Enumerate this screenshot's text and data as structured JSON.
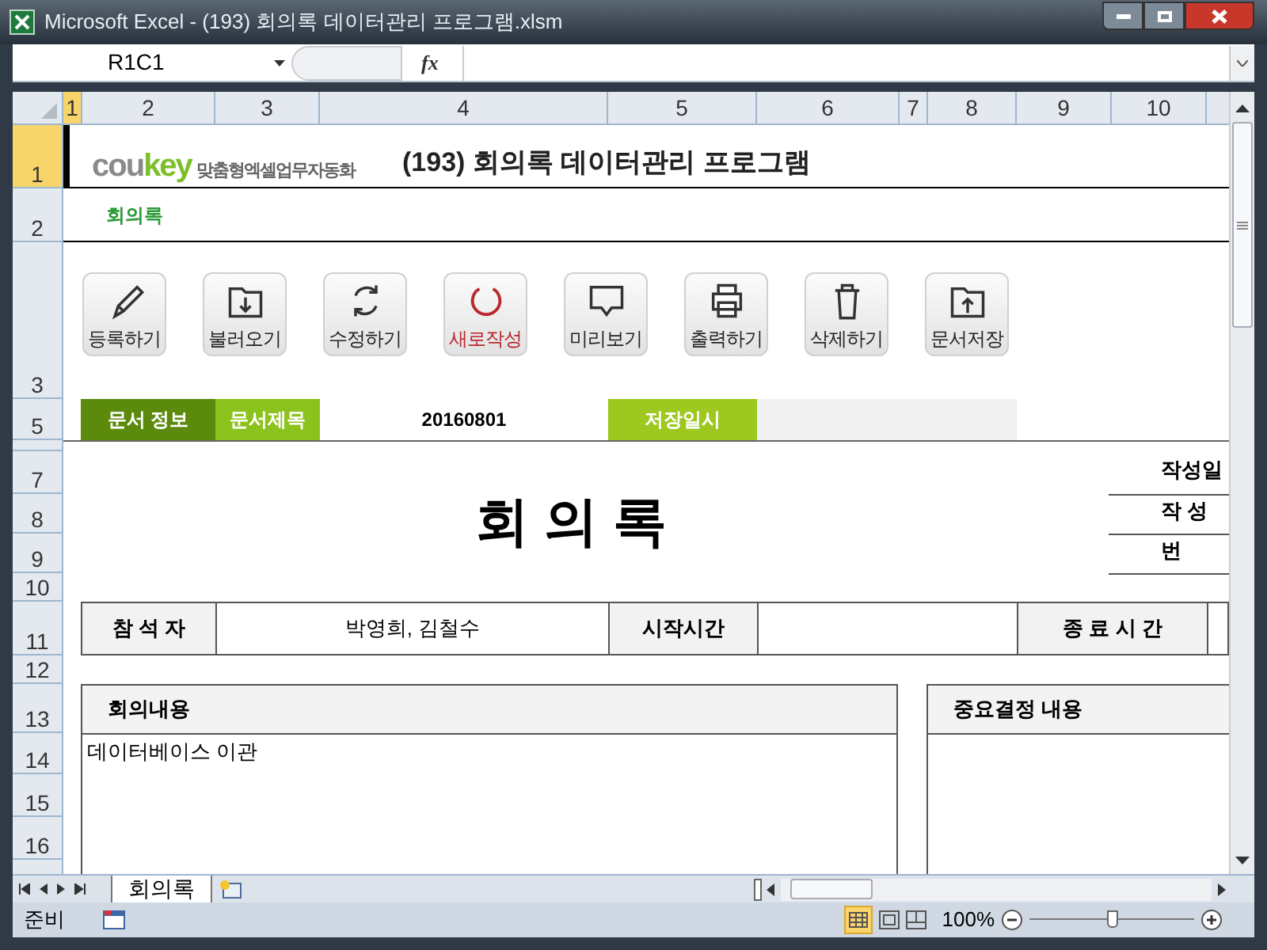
{
  "window": {
    "title": "Microsoft Excel - (193) 회의록 데이터관리 프로그램.xlsm"
  },
  "formula_bar": {
    "name_box": "R1C1",
    "function_label": "fx"
  },
  "column_headers": [
    "1",
    "2",
    "3",
    "4",
    "5",
    "6",
    "7",
    "8",
    "9",
    "10"
  ],
  "row_headers": [
    "1",
    "2",
    "3",
    "5",
    "7",
    "8",
    "9",
    "10",
    "11",
    "12",
    "13",
    "14",
    "15",
    "16"
  ],
  "header": {
    "brand_gray": "cou",
    "brand_green": "key",
    "tagline": "맞춤형엑셀업무자동화",
    "title": "(193) 회의록 데이터관리 프로그램",
    "subtitle": "회의록"
  },
  "toolbar": [
    {
      "label": "등록하기",
      "kind": "pencil",
      "highlighted": false
    },
    {
      "label": "불러오기",
      "kind": "folder-down",
      "highlighted": false
    },
    {
      "label": "수정하기",
      "kind": "refresh",
      "highlighted": false
    },
    {
      "label": "새로작성",
      "kind": "circle",
      "highlighted": true
    },
    {
      "label": "미리보기",
      "kind": "monitor",
      "highlighted": false
    },
    {
      "label": "출력하기",
      "kind": "printer",
      "highlighted": false
    },
    {
      "label": "삭제하기",
      "kind": "trash",
      "highlighted": false
    },
    {
      "label": "문서저장",
      "kind": "folder-up",
      "highlighted": false
    }
  ],
  "info_bar": {
    "section_label": "문서 정보",
    "title_label": "문서제목",
    "title_value": "20160801",
    "saved_label": "저장일시"
  },
  "document": {
    "heading": "회 의 록",
    "meta_labels": [
      "작성일",
      "작 성",
      "번"
    ]
  },
  "attendance": {
    "attendees_label": "참 석 자",
    "attendees": "박영희, 김철수",
    "start_label": "시작시간",
    "end_label": "종 료 시 간"
  },
  "sections": [
    {
      "title": "회의내용",
      "body": "데이터베이스 이관"
    },
    {
      "title": "중요결정 내용"
    }
  ],
  "sheet_tabs": [
    {
      "label": "회의록",
      "selected": true
    }
  ],
  "status_bar": {
    "mode": "준비",
    "zoom": "100%",
    "zoom_slider": {
      "level": 0.5
    }
  }
}
